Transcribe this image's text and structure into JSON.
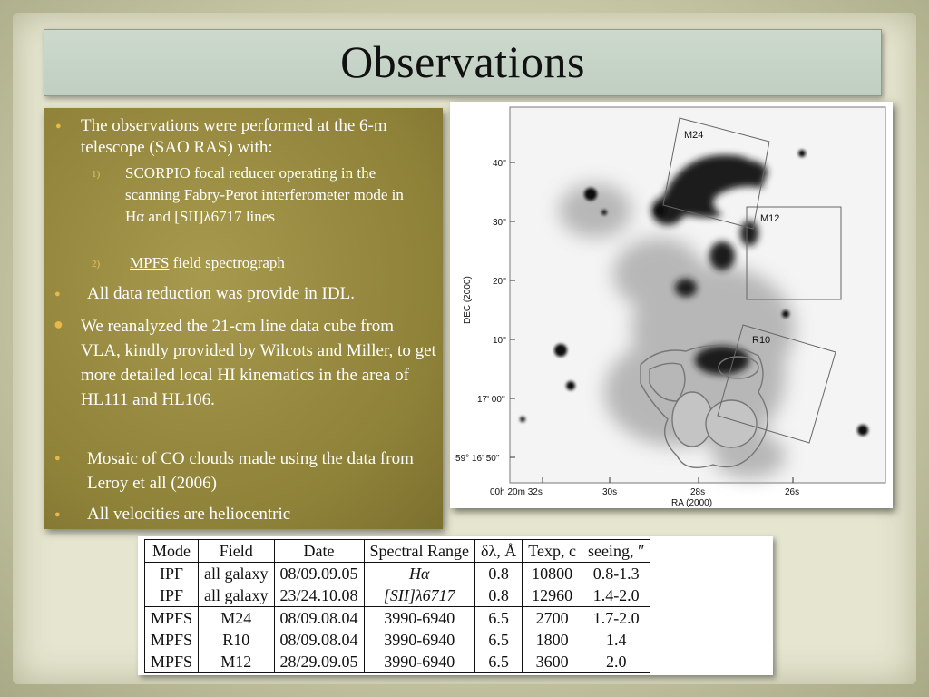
{
  "slide": {
    "title": "Observations"
  },
  "bullets": {
    "b1": "The observations were performed at the 6-m telescope  (SAO RAS) with:",
    "b1_sub1_num": "1)",
    "b1_sub1_pre": "SCORPIO focal reducer operating in the scanning ",
    "b1_sub1_link": "Fabry-Perot",
    "b1_sub1_post": " interferometer mode in Hα and [SII]λ6717 lines",
    "b1_sub2_num": "2)",
    "b1_sub2_link": "MPFS",
    "b1_sub2_post": " field spectrograph",
    "b2": "All data reduction was provide in IDL.",
    "b3": "We reanalyzed the 21-cm line data cube from VLA, kindly provided by Wilcots and Miller, to get more detailed local HI kinematics in the area of HL111 and HL106.",
    "b4": "Mosaic of CO clouds made using the data from Leroy et all (2006)",
    "b5": "All velocities are heliocentric"
  },
  "figure": {
    "box_labels": [
      "M24",
      "M12",
      "R10"
    ],
    "y_ticks": [
      "40''",
      "30''",
      "20''",
      "10''",
      "17' 00''",
      "59° 16' 50''"
    ],
    "x_ticks": [
      "00h 20m 32s",
      "30s",
      "28s",
      "26s"
    ],
    "ylabel": "DEC (2000)",
    "xlabel": "RA (2000)"
  },
  "table": {
    "headers": [
      "Mode",
      "Field",
      "Date",
      "Spectral Range",
      "δλ, Å",
      "Texp, c",
      "seeing, ″"
    ],
    "rows": [
      [
        "IPF",
        "all galaxy",
        "08/09.09.05",
        "Hα",
        "0.8",
        "10800",
        "0.8-1.3"
      ],
      [
        "IPF",
        "all galaxy",
        "23/24.10.08",
        "[SII]λ6717",
        "0.8",
        "12960",
        "1.4-2.0"
      ],
      [
        "MPFS",
        "M24",
        "08/09.08.04",
        "3990-6940",
        "6.5",
        "2700",
        "1.7-2.0"
      ],
      [
        "MPFS",
        "R10",
        "08/09.08.04",
        "3990-6940",
        "6.5",
        "1800",
        "1.4"
      ],
      [
        "MPFS",
        "M12",
        "28/29.09.05",
        "3990-6940",
        "6.5",
        "3600",
        "2.0"
      ]
    ]
  },
  "colors": {
    "panel": "#8e8138",
    "bullet": "#e8b84a",
    "title_bar": "#c4d2c5"
  }
}
